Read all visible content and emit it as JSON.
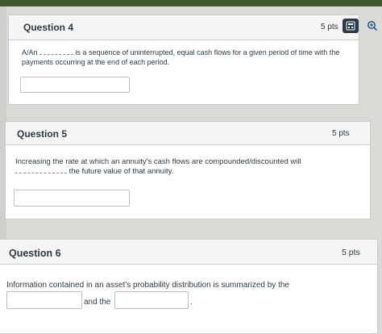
{
  "questions": [
    {
      "title": "Question 4",
      "points": "5 pts",
      "text_before": "A/An",
      "text_after": "is a sequence of uninterrupted, equal cash flows for a given period of time with the payments occurring at the end of each period."
    },
    {
      "title": "Question 5",
      "points": "5 pts",
      "text_before": "Increasing the rate at which an annuity's cash flows are compounded/discounted will",
      "text_after": "the future value of that annuity."
    },
    {
      "title": "Question 6",
      "points": "5 pts",
      "text": "Information contained in an asset's probability distribution is summarized by the",
      "connector": "and the",
      "end": "."
    }
  ],
  "toolbar": {
    "icons": [
      "calculator-icon",
      "zoom-icon"
    ],
    "icon_colors": {
      "calculator": "#2b3a4a",
      "zoom": "#2f5d8a"
    }
  }
}
